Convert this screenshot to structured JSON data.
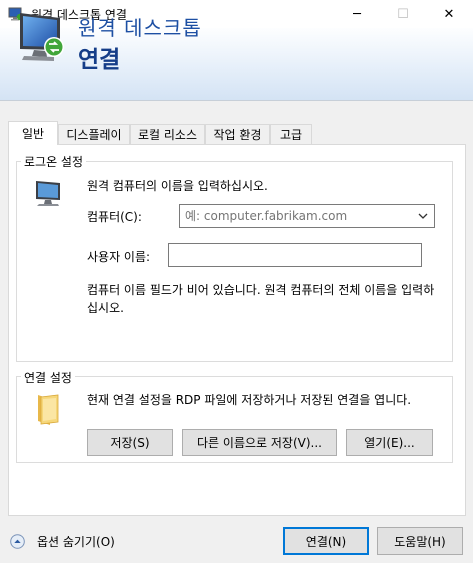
{
  "window": {
    "title": "원격 데스크톱 연결",
    "controls": {
      "minimize": "─",
      "maximize": "☐",
      "close": "✕"
    }
  },
  "banner": {
    "line1": "원격 데스크톱",
    "line2": "연결",
    "text_color": "#1d4fa3"
  },
  "tabs": [
    {
      "label": "일반",
      "active": true
    },
    {
      "label": "디스플레이",
      "active": false
    },
    {
      "label": "로컬 리소스",
      "active": false
    },
    {
      "label": "작업 환경",
      "active": false
    },
    {
      "label": "고급",
      "active": false
    }
  ],
  "logon": {
    "group_title": "로그온 설정",
    "instruction": "원격 컴퓨터의 이름을 입력하십시오.",
    "computer_label": "컴퓨터(C):",
    "computer_placeholder": "예: computer.fabrikam.com",
    "user_label": "사용자 이름:",
    "user_value": "",
    "warning": "컴퓨터 이름 필드가 비어 있습니다. 원격 컴퓨터의 전체 이름을 입력하십시오."
  },
  "connection": {
    "group_title": "연결 설정",
    "description": "현재 연결 설정을 RDP 파일에 저장하거나 저장된 연결을 엽니다.",
    "save_label": "저장(S)",
    "save_as_label": "다른 이름으로 저장(V)...",
    "open_label": "열기(E)..."
  },
  "footer": {
    "options_label": "옵션 숨기기(O)",
    "connect_label": "연결(N)",
    "help_label": "도움말(H)"
  },
  "colors": {
    "accent": "#0078d7",
    "banner_title": "#153d88"
  }
}
